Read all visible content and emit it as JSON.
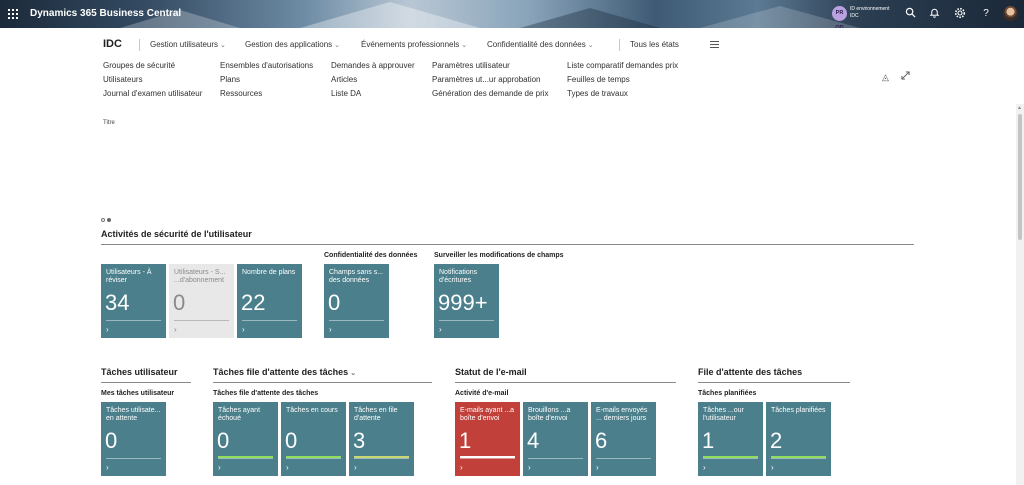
{
  "topbar": {
    "app_title": "Dynamics 365 Business Central",
    "env_badge": "PR OD",
    "env_name": "ID environnement",
    "env_company": "IDC",
    "icons": [
      "waffle-icon",
      "search-icon",
      "bell-icon",
      "gear-icon",
      "help-icon",
      "avatar"
    ]
  },
  "nav": {
    "company": "IDC",
    "items": [
      {
        "label": "Gestion utilisateurs",
        "dropdown": true
      },
      {
        "label": "Gestion des applications",
        "dropdown": true
      },
      {
        "label": "Événements professionnels",
        "dropdown": true
      },
      {
        "label": "Confidentialité des données",
        "dropdown": true
      },
      {
        "label": "Tous les états",
        "dropdown": false
      }
    ]
  },
  "actions": {
    "col1": [
      "Groupes de sécurité",
      "Utilisateurs",
      "Journal d'examen utilisateur"
    ],
    "col2": [
      "Ensembles d'autorisations",
      "Plans",
      "Ressources"
    ],
    "col3": [
      "Demandes à approuver",
      "Articles",
      "Liste DA"
    ],
    "col4": [
      "Paramètres utilisateur",
      "Paramètres ut...ur approbation",
      "Génération des demande de prix"
    ],
    "col5": [
      "Liste comparatif demandes prix",
      "Feuilles de temps",
      "Types de travaux"
    ]
  },
  "headline": {
    "title_label": "Titre"
  },
  "security": {
    "title": "Activités de sécurité de l'utilisateur",
    "tiles": [
      {
        "label": "Utilisateurs - À réviser",
        "value": "34"
      },
      {
        "label": "Utilisateurs - S... ...d'abonnement",
        "value": "0"
      },
      {
        "label": "Nombre de plans",
        "value": "22"
      }
    ],
    "privacy_group": "Confidentialité des données",
    "privacy_tile": {
      "label": "Champs sans s... des données",
      "value": "0"
    },
    "monitor_group": "Surveiller les modifications de champs",
    "monitor_tile": {
      "label": "Notifications d'écritures",
      "value": "999+"
    }
  },
  "user_tasks": {
    "title": "Tâches utilisateur",
    "group": "Mes tâches utilisateur",
    "tile": {
      "label": "Tâches utilisate... en attente",
      "value": "0"
    }
  },
  "queue_tasks": {
    "title": "Tâches file d'attente des tâches",
    "group": "Tâches file d'attente des tâches",
    "tiles": [
      {
        "label": "Tâches ayant échoué",
        "value": "0",
        "progress": 1.0,
        "progress_color": "#8fdc5e"
      },
      {
        "label": "Tâches en cours",
        "value": "0",
        "progress": 1.0,
        "progress_color": "#8fdc5e"
      },
      {
        "label": "Tâches en file d'attente",
        "value": "3",
        "progress": 1.0,
        "progress_color": "#c9d873"
      }
    ]
  },
  "email": {
    "title": "Statut de l'e-mail",
    "group": "Activité d'e-mail",
    "tiles": [
      {
        "label": "E-mails ayant ...a boîte d'envoi",
        "value": "1",
        "progress": 1.0,
        "progress_color": "#ffffff"
      },
      {
        "label": "Brouillons ...a boîte d'envoi",
        "value": "4"
      },
      {
        "label": "E-mails envoyés ... derniers jours",
        "value": "6"
      }
    ]
  },
  "job_queue": {
    "title": "File d'attente des tâches",
    "group": "Tâches planifiées",
    "tiles": [
      {
        "label": "Tâches ...our l'utilisateur",
        "value": "1",
        "progress": 1.0,
        "progress_color": "#8fdc5e"
      },
      {
        "label": "Tâches planifiées",
        "value": "2",
        "progress": 1.0,
        "progress_color": "#8fdc5e"
      }
    ]
  }
}
